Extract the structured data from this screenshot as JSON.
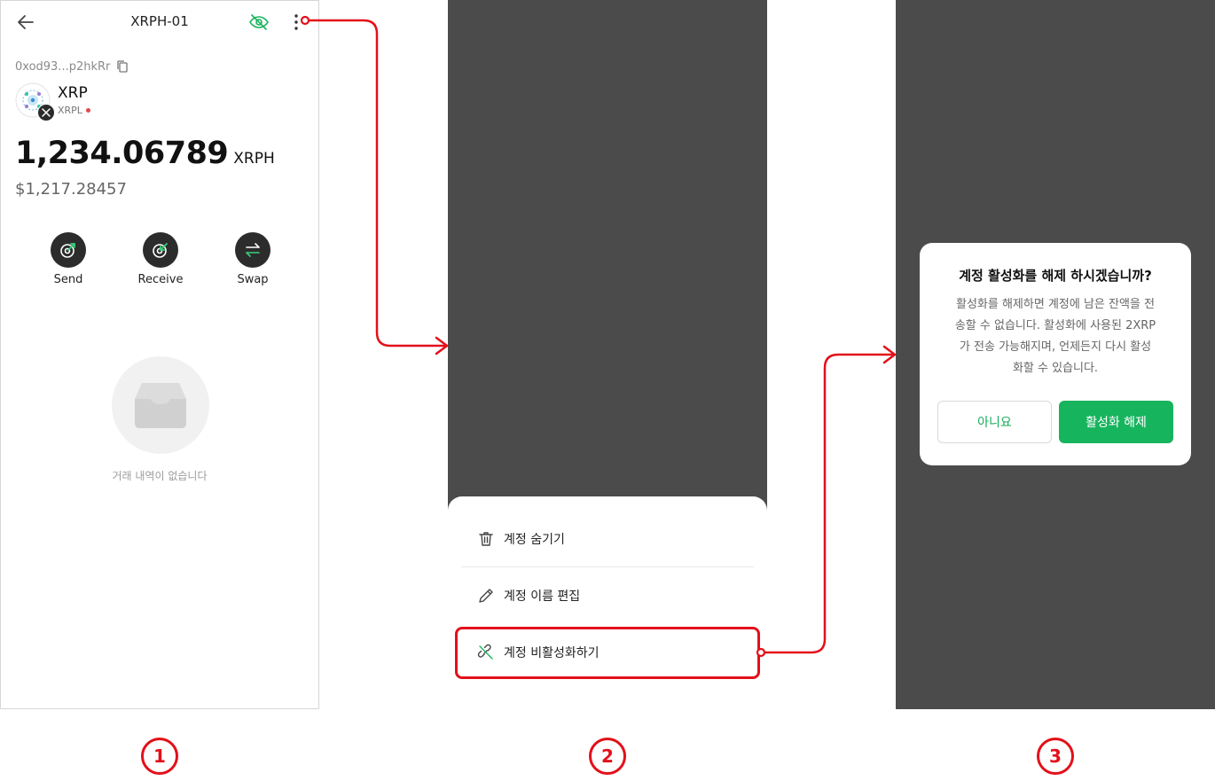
{
  "screen1": {
    "title": "XRPH-01",
    "address": "0xod93...p2hkRr",
    "asset_name": "XRP",
    "chain": "XRPL",
    "balance": "1,234.06789",
    "unit": "XRPH",
    "fiat": "$1,217.28457",
    "actions": [
      {
        "label": "Send"
      },
      {
        "label": "Receive"
      },
      {
        "label": "Swap"
      }
    ],
    "empty_text": "거래 내역이 없습니다"
  },
  "screen2": {
    "menu": [
      {
        "label": "계정 숨기기",
        "icon": "trash-icon"
      },
      {
        "label": "계정 이름 편집",
        "icon": "pencil-icon"
      },
      {
        "label": "계정 비활성화하기",
        "icon": "unlink-icon"
      }
    ]
  },
  "screen3": {
    "title": "계정 활성화를 해제 하시겠습니까?",
    "body_lines": [
      "활성화를 해제하면 계정에 남은 잔액을 전",
      "송할 수 없습니다. 활성화에 사용된 2XRP",
      "가 전송 가능해지며, 언제든지 다시 활성",
      "화할 수 있습니다."
    ],
    "cancel_label": "아니요",
    "confirm_label": "활성화 해제"
  },
  "steps": [
    "1",
    "2",
    "3"
  ],
  "colors": {
    "accent_green": "#17b45e",
    "annotation_red": "#e3101a",
    "overlay_dim": "#4b4b4b"
  }
}
